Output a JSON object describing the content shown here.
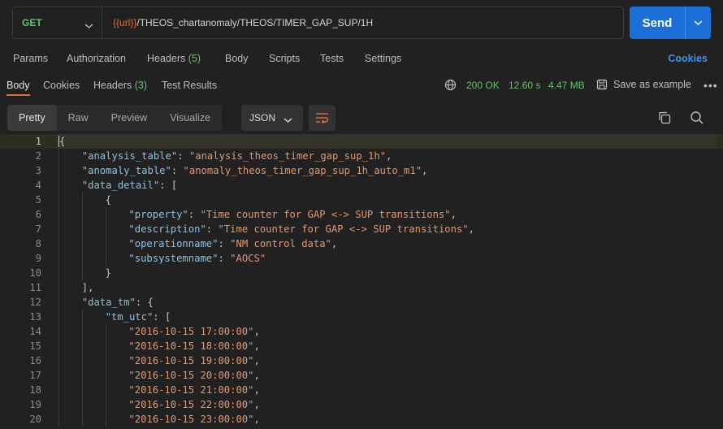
{
  "request": {
    "method": "GET",
    "url_var": "{{url}}",
    "url_path": "/THEOS_chartanomaly/THEOS/TIMER_GAP_SUP/1H",
    "send_label": "Send"
  },
  "request_tabs": {
    "params": "Params",
    "authorization": "Authorization",
    "headers": "Headers",
    "headers_count": "(5)",
    "body": "Body",
    "scripts": "Scripts",
    "tests": "Tests",
    "settings": "Settings",
    "cookies": "Cookies"
  },
  "response_tabs": {
    "body": "Body",
    "cookies": "Cookies",
    "headers": "Headers",
    "headers_count": "(3)",
    "test_results": "Test Results"
  },
  "response_status": {
    "code": "200 OK",
    "time": "12.60 s",
    "size": "4.47 MB",
    "save_example": "Save as example"
  },
  "view": {
    "modes": [
      "Pretty",
      "Raw",
      "Preview",
      "Visualize"
    ],
    "active_mode": "Pretty",
    "format": "JSON"
  },
  "icons": {
    "method_dropdown": "chevron-down-icon",
    "send_dropdown": "chevron-down-icon",
    "globe": "globe-icon",
    "save": "save-icon",
    "more": "more-icon",
    "wrap": "wrap-lines-icon",
    "copy": "copy-icon",
    "search": "search-icon"
  },
  "colors": {
    "method": "#5ec46b",
    "send_button": "#1d6fd8",
    "accent": "#e06c3a",
    "status_ok": "#5ec46b",
    "json_key": "#85c4e8",
    "json_string": "#e4976b",
    "cookies_link": "#3d90f0"
  },
  "code_lines": [
    {
      "n": "1",
      "indent": 0,
      "parts": [
        [
          "p",
          "{"
        ]
      ]
    },
    {
      "n": "2",
      "indent": 1,
      "parts": [
        [
          "k",
          "\"analysis_table\""
        ],
        [
          "p",
          ": "
        ],
        [
          "s",
          "\"analysis_theos_timer_gap_sup_1h\""
        ],
        [
          "p",
          ","
        ]
      ]
    },
    {
      "n": "3",
      "indent": 1,
      "parts": [
        [
          "k",
          "\"anomaly_table\""
        ],
        [
          "p",
          ": "
        ],
        [
          "s",
          "\"anomaly_theos_timer_gap_sup_1h_auto_m1\""
        ],
        [
          "p",
          ","
        ]
      ]
    },
    {
      "n": "4",
      "indent": 1,
      "parts": [
        [
          "k",
          "\"data_detail\""
        ],
        [
          "p",
          ": ["
        ]
      ]
    },
    {
      "n": "5",
      "indent": 2,
      "parts": [
        [
          "p",
          "{"
        ]
      ]
    },
    {
      "n": "6",
      "indent": 3,
      "parts": [
        [
          "k",
          "\"property\""
        ],
        [
          "p",
          ": "
        ],
        [
          "s",
          "\"Time counter for GAP <-> SUP transitions\""
        ],
        [
          "p",
          ","
        ]
      ]
    },
    {
      "n": "7",
      "indent": 3,
      "parts": [
        [
          "k",
          "\"description\""
        ],
        [
          "p",
          ": "
        ],
        [
          "s",
          "\"Time counter for GAP <-> SUP transitions\""
        ],
        [
          "p",
          ","
        ]
      ]
    },
    {
      "n": "8",
      "indent": 3,
      "parts": [
        [
          "k",
          "\"operationname\""
        ],
        [
          "p",
          ": "
        ],
        [
          "s",
          "\"NM control data\""
        ],
        [
          "p",
          ","
        ]
      ]
    },
    {
      "n": "9",
      "indent": 3,
      "parts": [
        [
          "k",
          "\"subsystemname\""
        ],
        [
          "p",
          ": "
        ],
        [
          "s",
          "\"AOCS\""
        ]
      ]
    },
    {
      "n": "10",
      "indent": 2,
      "parts": [
        [
          "p",
          "}"
        ]
      ]
    },
    {
      "n": "11",
      "indent": 1,
      "parts": [
        [
          "p",
          "],"
        ]
      ]
    },
    {
      "n": "12",
      "indent": 1,
      "parts": [
        [
          "k",
          "\"data_tm\""
        ],
        [
          "p",
          ": {"
        ]
      ]
    },
    {
      "n": "13",
      "indent": 2,
      "parts": [
        [
          "k",
          "\"tm_utc\""
        ],
        [
          "p",
          ": ["
        ]
      ]
    },
    {
      "n": "14",
      "indent": 3,
      "parts": [
        [
          "s",
          "\"2016-10-15 17:00:00\""
        ],
        [
          "p",
          ","
        ]
      ]
    },
    {
      "n": "15",
      "indent": 3,
      "parts": [
        [
          "s",
          "\"2016-10-15 18:00:00\""
        ],
        [
          "p",
          ","
        ]
      ]
    },
    {
      "n": "16",
      "indent": 3,
      "parts": [
        [
          "s",
          "\"2016-10-15 19:00:00\""
        ],
        [
          "p",
          ","
        ]
      ]
    },
    {
      "n": "17",
      "indent": 3,
      "parts": [
        [
          "s",
          "\"2016-10-15 20:00:00\""
        ],
        [
          "p",
          ","
        ]
      ]
    },
    {
      "n": "18",
      "indent": 3,
      "parts": [
        [
          "s",
          "\"2016-10-15 21:00:00\""
        ],
        [
          "p",
          ","
        ]
      ]
    },
    {
      "n": "19",
      "indent": 3,
      "parts": [
        [
          "s",
          "\"2016-10-15 22:00:00\""
        ],
        [
          "p",
          ","
        ]
      ]
    },
    {
      "n": "20",
      "indent": 3,
      "parts": [
        [
          "s",
          "\"2016-10-15 23:00:00\""
        ],
        [
          "p",
          ","
        ]
      ]
    }
  ]
}
